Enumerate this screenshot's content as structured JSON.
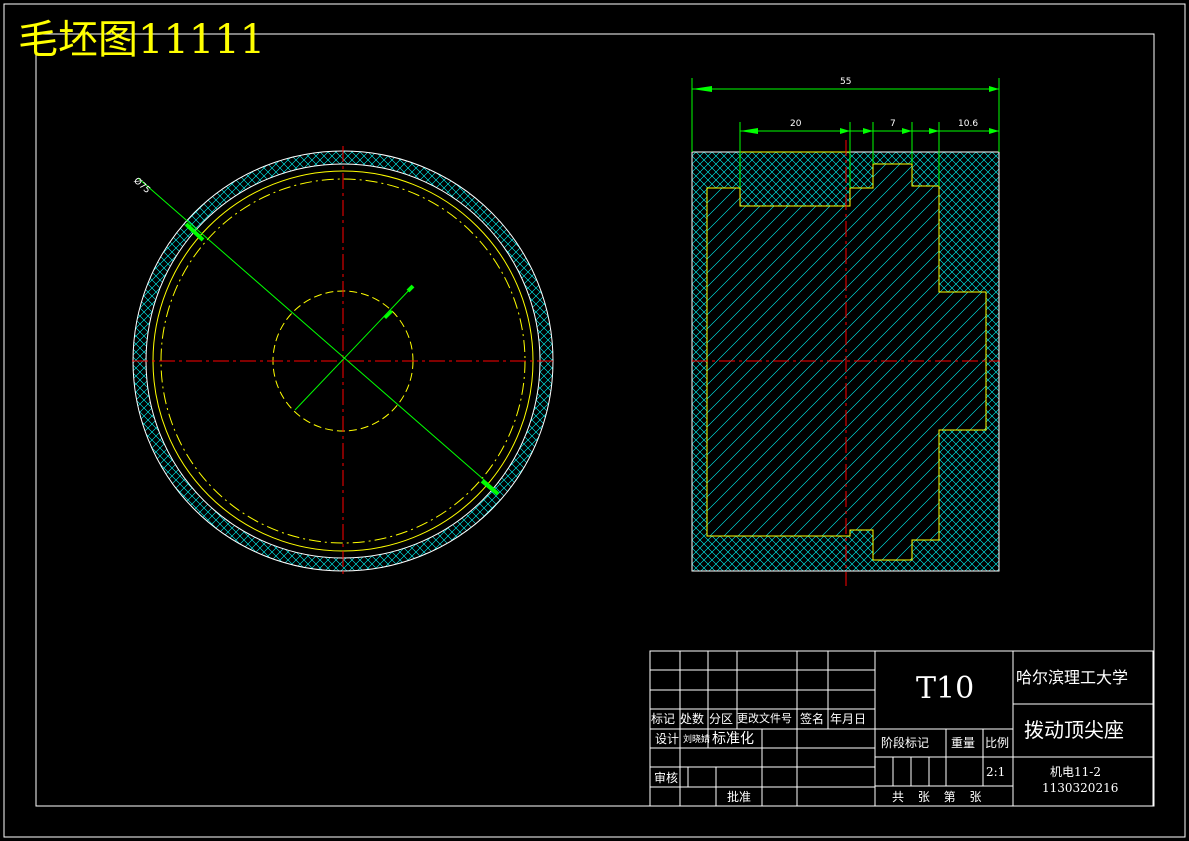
{
  "drawing": {
    "title": "毛坯图11111",
    "dimensions": {
      "outer_diameter": "Ø75",
      "overall_length": "55",
      "dim_a": "20",
      "dim_b": "7",
      "dim_c": "10.6"
    }
  },
  "title_block": {
    "material": "T10",
    "university": "哈尔滨理工大学",
    "part_name": "拨动顶尖座",
    "class": "机电11-2",
    "student_id": "1130320216",
    "scale": "2:1",
    "sheet": "共 张 第 张",
    "headers": {
      "mark": "标记",
      "count": "处数",
      "zone": "分区",
      "doc_no": "更改文件号",
      "signature": "签名",
      "date": "年月日",
      "design": "设计",
      "design_name": "刘晓婧",
      "standard": "标准化",
      "review": "审核",
      "approve": "批准",
      "stage": "阶段标记",
      "weight": "重量",
      "ratio": "比例"
    }
  },
  "colors": {
    "frame": "#ffffff",
    "centerline": "#ff0000",
    "hatch": "#00ffff",
    "dimension": "#00ff00",
    "hidden": "#ffff00",
    "profile": "#ffff00"
  }
}
